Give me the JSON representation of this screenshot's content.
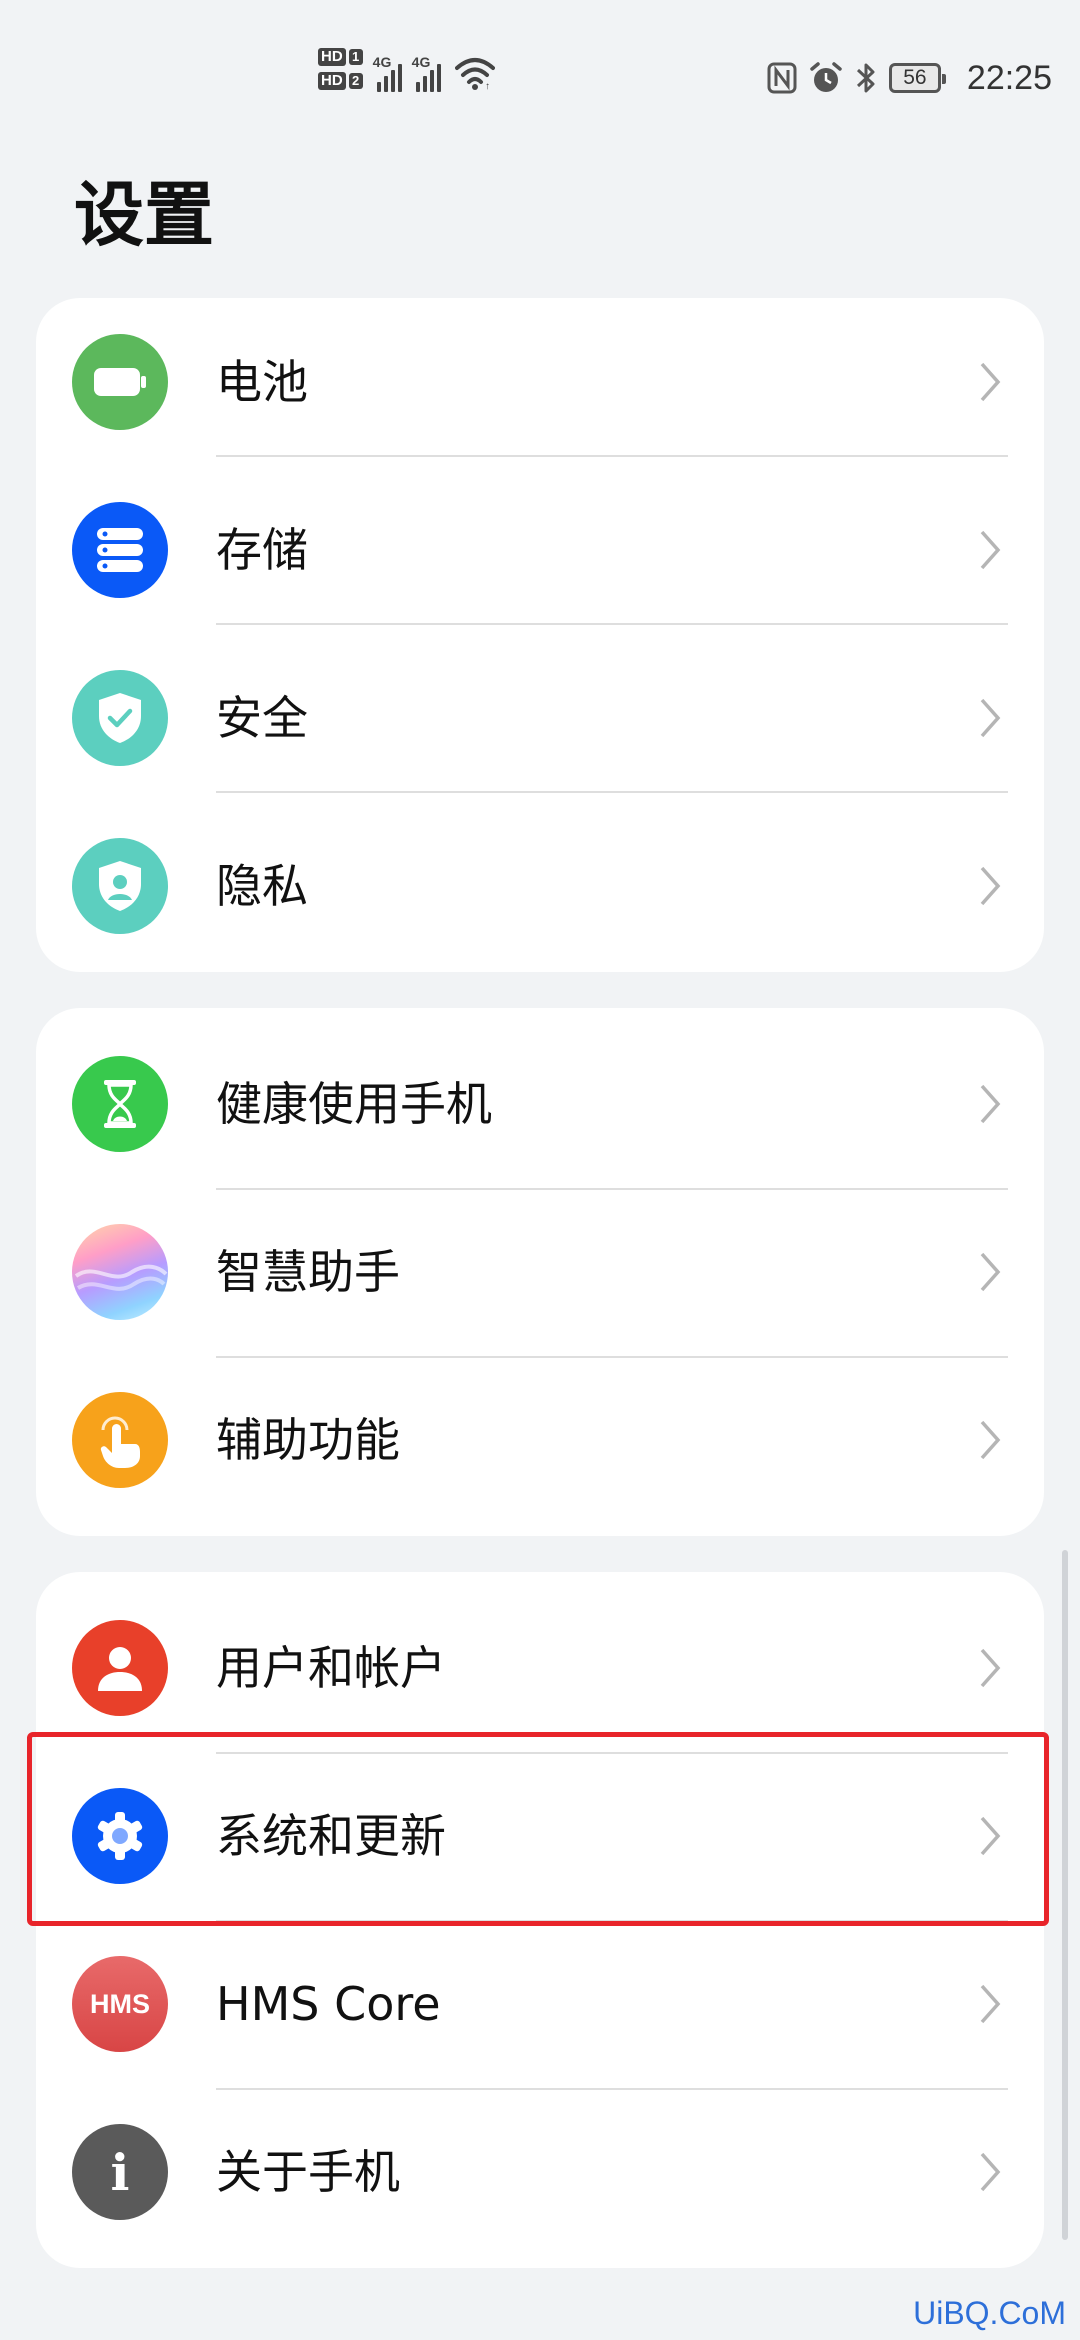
{
  "status_bar": {
    "sim1_label": "HD",
    "sim1_num": "1",
    "sim2_label": "HD",
    "sim2_num": "2",
    "net1": "4G",
    "net2": "4G",
    "battery_level": "56",
    "time": "22:25",
    "icons": [
      "nfc-icon",
      "alarm-icon",
      "bluetooth-icon"
    ]
  },
  "page": {
    "title": "设置"
  },
  "groups": [
    {
      "items": [
        {
          "label": "电池",
          "icon": "battery-icon",
          "color": "#5cb85c"
        },
        {
          "label": "存储",
          "icon": "storage-icon",
          "color": "#0a59f7"
        },
        {
          "label": "安全",
          "icon": "shield-check-icon",
          "color": "#5ccfbf"
        },
        {
          "label": "隐私",
          "icon": "privacy-shield-icon",
          "color": "#5ccfbf"
        }
      ]
    },
    {
      "items": [
        {
          "label": "健康使用手机",
          "icon": "hourglass-icon",
          "color": "#38c94d"
        },
        {
          "label": "智慧助手",
          "icon": "assistant-icon",
          "color": "#c9a6ff"
        },
        {
          "label": "辅助功能",
          "icon": "hand-tap-icon",
          "color": "#f7a21b"
        }
      ]
    },
    {
      "items": [
        {
          "label": "用户和帐户",
          "icon": "user-icon",
          "color": "#e8402a"
        },
        {
          "label": "系统和更新",
          "icon": "gear-icon",
          "color": "#0a59f7"
        },
        {
          "label": "HMS Core",
          "icon": "hms-icon",
          "color": "#e05555",
          "icon_text": "HMS"
        },
        {
          "label": "关于手机",
          "icon": "info-icon",
          "color": "#5a5a5a",
          "icon_text": "i"
        }
      ]
    }
  ],
  "highlight_color": "#e8242a",
  "watermark": "UiBQ.CoM"
}
